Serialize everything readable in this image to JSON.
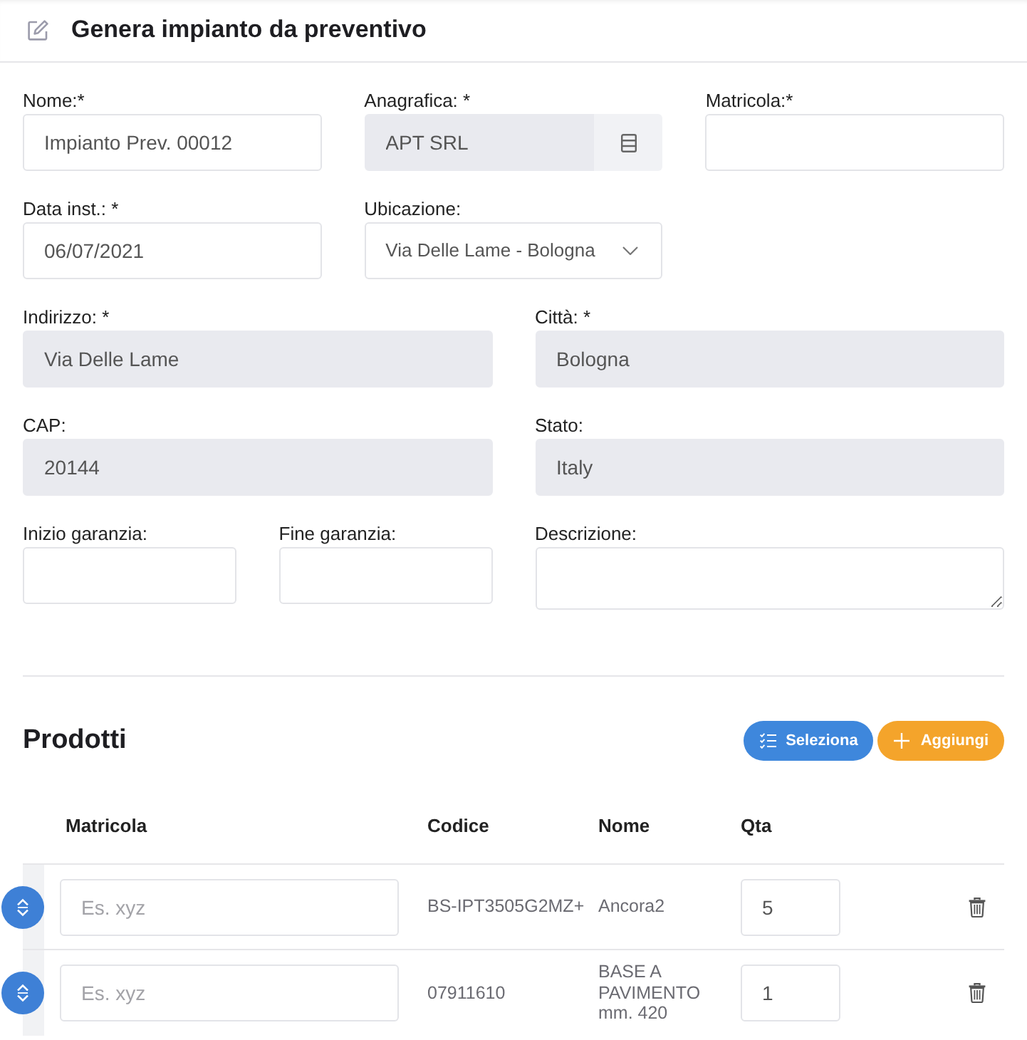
{
  "header": {
    "title": "Genera impianto da preventivo"
  },
  "form": {
    "rows": [
      [
        {
          "label": "Nome:*",
          "kind": "text",
          "value": "Impianto Prev. 00012",
          "disabled": false
        },
        {
          "label": "Anagrafica: *",
          "kind": "lookup",
          "value": "APT SRL",
          "disabled": true
        },
        {
          "label": "Matricola:*",
          "kind": "text",
          "disabled": false
        }
      ],
      [
        {
          "label": "Data inst.: *",
          "kind": "text",
          "value": "06/07/2021",
          "disabled": false
        },
        {
          "label": "Ubicazione:",
          "kind": "select",
          "value": "Via Delle Lame - Bologna",
          "disabled": false
        }
      ],
      [
        {
          "label": "Indirizzo: *",
          "kind": "text",
          "value": "Via Delle Lame",
          "disabled": true
        },
        {
          "label": "Città: *",
          "kind": "text",
          "value": "Bologna",
          "disabled": true
        }
      ],
      [
        {
          "label": "CAP:",
          "kind": "text",
          "value": "20144",
          "disabled": true
        },
        {
          "label": "Stato:",
          "kind": "text",
          "value": "Italy",
          "disabled": true
        }
      ],
      [
        {
          "label": "Inizio garanzia:",
          "kind": "text",
          "disabled": false
        },
        {
          "label": "Fine garanzia:",
          "kind": "text",
          "disabled": false
        },
        {
          "label": "Descrizione:",
          "kind": "textarea",
          "disabled": false
        }
      ]
    ]
  },
  "products": {
    "title": "Prodotti",
    "buttons": [
      {
        "label": "Seleziona",
        "kind": "select"
      },
      {
        "label": "Aggiungi",
        "kind": "add"
      }
    ],
    "columns": [
      "Matricola",
      "Codice",
      "Nome",
      "Qta"
    ],
    "rows": [
      {
        "matricola": {
          "placeholder": "Es. xyz"
        },
        "codice": "BS-IPT3505G2MZ+",
        "nome": "Ancora2",
        "qta": "5"
      },
      {
        "matricola": {
          "placeholder": "Es. xyz"
        },
        "codice": "07911610",
        "nome": "BASE A PAVIMENTO mm. 420",
        "qta": "1"
      }
    ]
  }
}
